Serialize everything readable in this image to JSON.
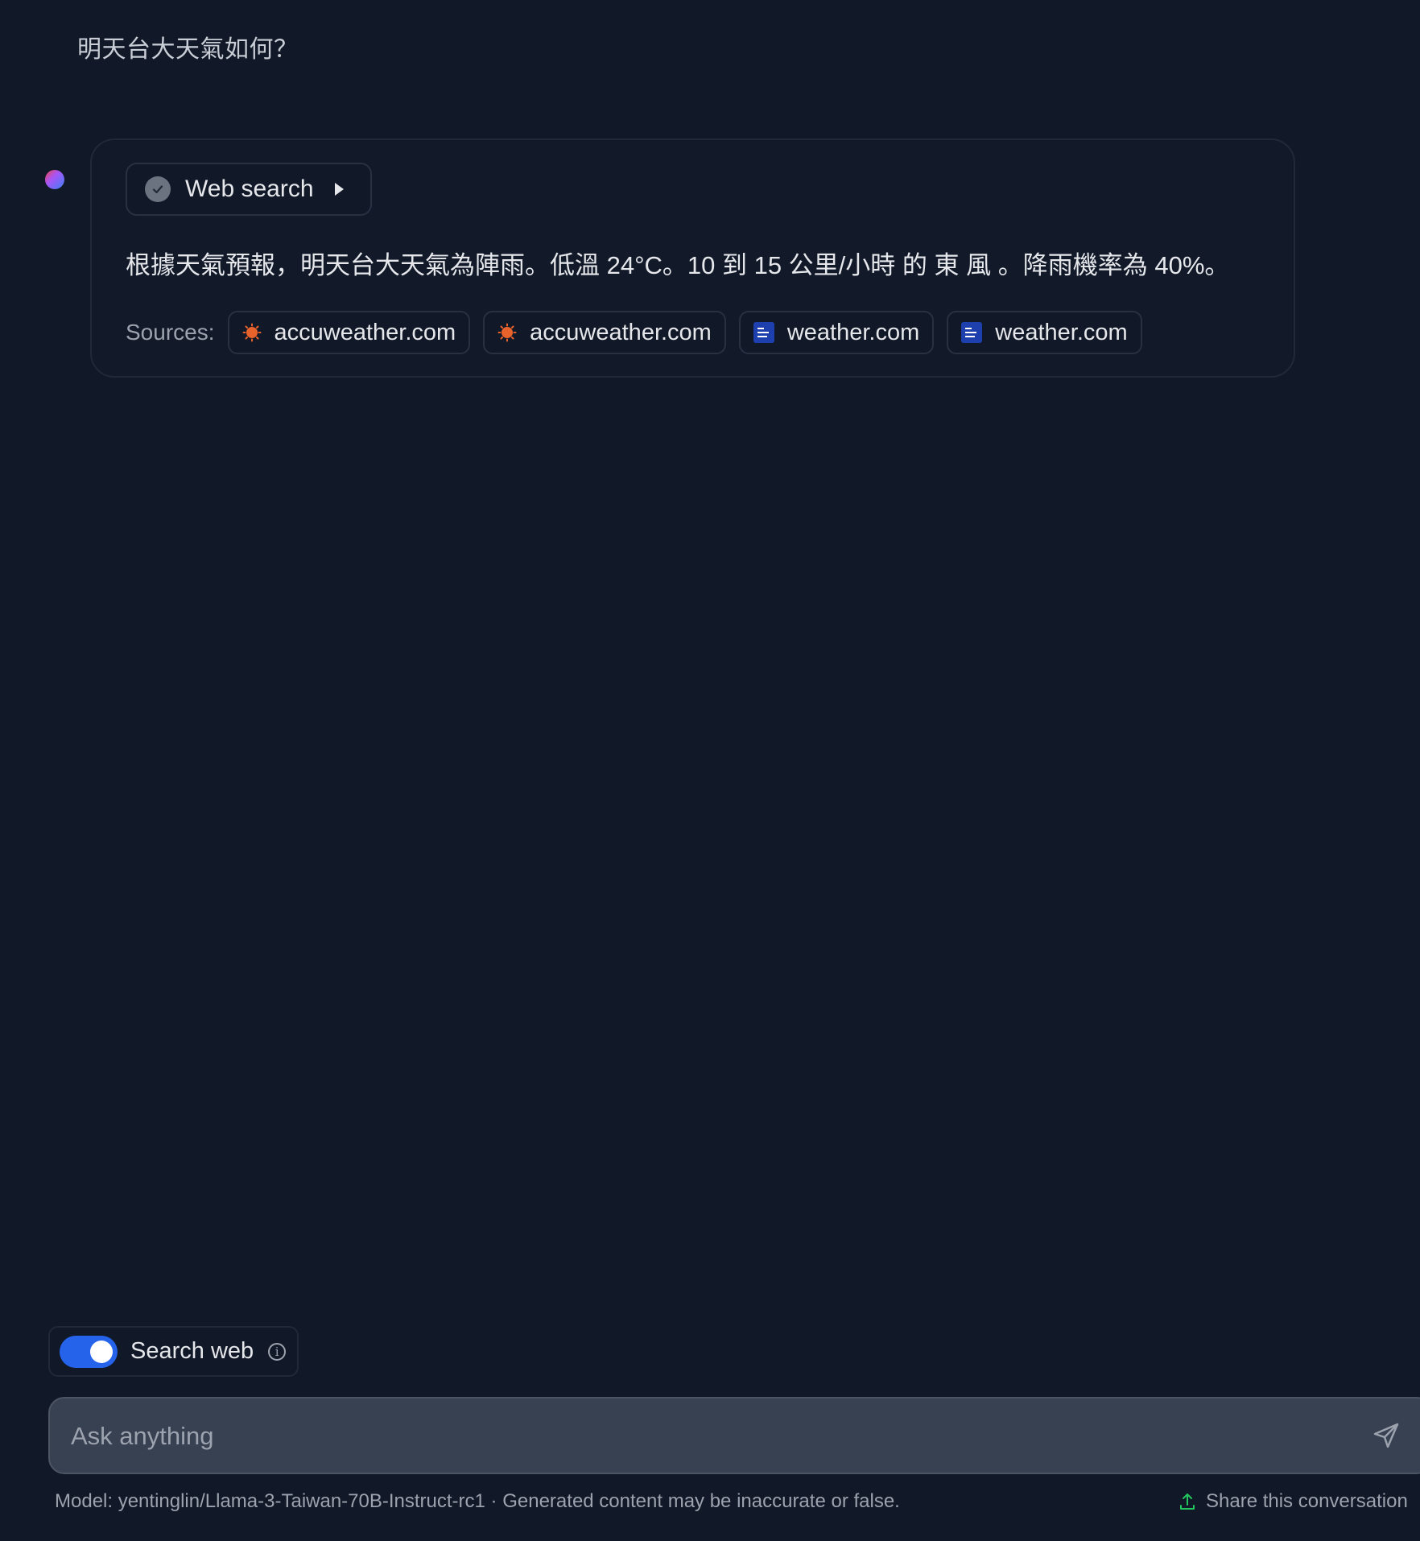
{
  "conversation": {
    "user_message": "明天台大天氣如何？",
    "assistant": {
      "tool": {
        "label": "Web search",
        "status_icon": "check-circle-icon",
        "expand_icon": "caret-right-icon"
      },
      "answer": "根據天氣預報，明天台大天氣為陣雨。低溫 24°C。10 到 15 公里/小時 的 東 風 。降雨機率為 40%。",
      "sources_label": "Sources:",
      "sources": [
        {
          "label": "accuweather.com",
          "icon": "accuweather-icon"
        },
        {
          "label": "accuweather.com",
          "icon": "accuweather-icon"
        },
        {
          "label": "weather.com",
          "icon": "weather-channel-icon"
        },
        {
          "label": "weather.com",
          "icon": "weather-channel-icon"
        }
      ]
    }
  },
  "composer": {
    "search_web": {
      "label": "Search web",
      "enabled": true
    },
    "input_placeholder": "Ask anything",
    "input_value": ""
  },
  "footer": {
    "model_notice": "Model: yentinglin/Llama-3-Taiwan-70B-Instruct-rc1 · Generated content may be inaccurate or false.",
    "share_label": "Share this conversation"
  },
  "colors": {
    "background": "#111827",
    "accent": "#2563eb",
    "accuweather": "#e8622c",
    "weather_channel": "#1e40af"
  }
}
